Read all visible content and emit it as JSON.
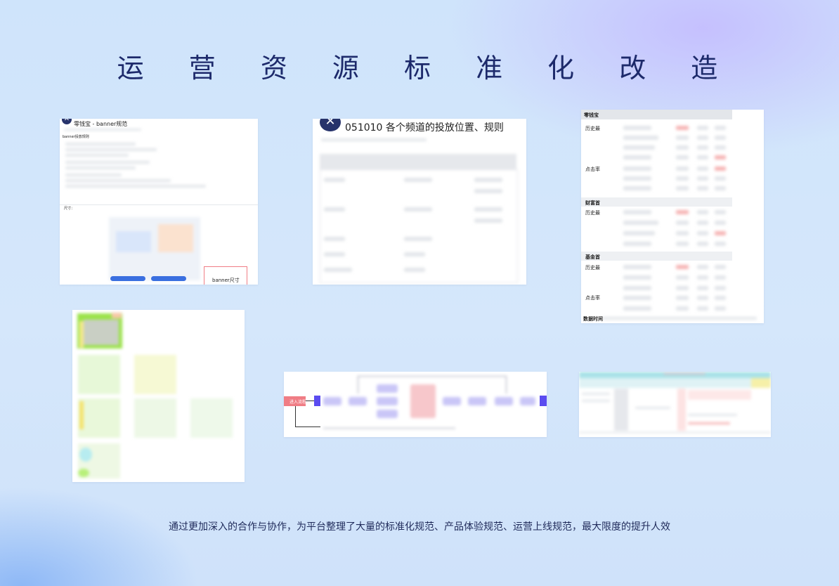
{
  "title": "运 营 资 源 标 准 化 改 造",
  "caption": "通过更加深入的合作与协作，为平台整理了大量的标准化规范、产品体验规范、运营上线规范，最大限度的提升人效",
  "card1": {
    "heading": "零钱宝 - banner规范",
    "sub_label": "banner投放规则",
    "size_label": "尺寸：",
    "banner_label": "banner尺寸"
  },
  "card2": {
    "heading": "051010 各个频道的投放位置、规则"
  },
  "card3": {
    "header": "零钱宝",
    "sections": [
      {
        "name": "财富首",
        "row1": "历史最"
      },
      {
        "name": "基金首",
        "row1": "历史最"
      }
    ],
    "row_hist": "历史最",
    "row_click": "点击率",
    "footer": "数据时间"
  },
  "card5": {
    "start_label": "进入流程"
  },
  "colors": {
    "accent": "#5b4cf0",
    "pink": "#f07d85",
    "title": "#1d2a6b"
  }
}
